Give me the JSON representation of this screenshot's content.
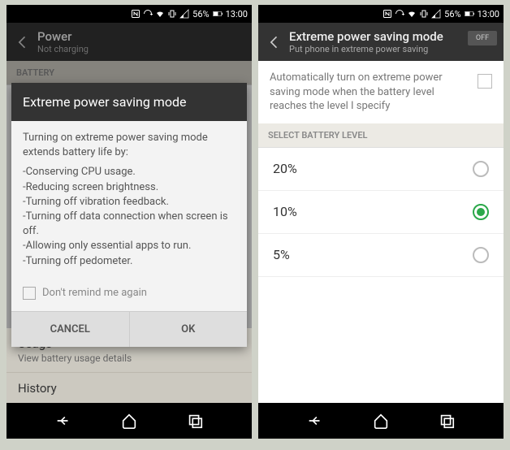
{
  "status": {
    "battery_pct": "56%",
    "time": "13:00"
  },
  "left": {
    "header": {
      "title": "Power",
      "subtitle": "Not charging"
    },
    "section_battery": "BATTERY",
    "dialog": {
      "title": "Extreme power saving mode",
      "intro": "Turning on extreme power saving mode extends battery life by:",
      "bullets": [
        "Conserving CPU usage.",
        "Reducing screen brightness.",
        "Turning off vibration feedback.",
        "Turning off data connection when screen is off.",
        "Allowing only essential apps to run.",
        "Turning off pedometer."
      ],
      "dont_remind": "Don't remind me again",
      "cancel": "CANCEL",
      "ok": "OK"
    },
    "usage": {
      "title": "Usage",
      "subtitle": "View battery usage details"
    },
    "history": {
      "title": "History"
    }
  },
  "right": {
    "header": {
      "title": "Extreme power saving mode",
      "subtitle": "Put phone in extreme power saving",
      "toggle": "OFF"
    },
    "auto_text": "Automatically turn on extreme power saving mode when the battery level reaches the level I specify",
    "select_header": "SELECT BATTERY LEVEL",
    "levels": [
      {
        "label": "20%",
        "selected": false
      },
      {
        "label": "10%",
        "selected": true
      },
      {
        "label": "5%",
        "selected": false
      }
    ]
  }
}
